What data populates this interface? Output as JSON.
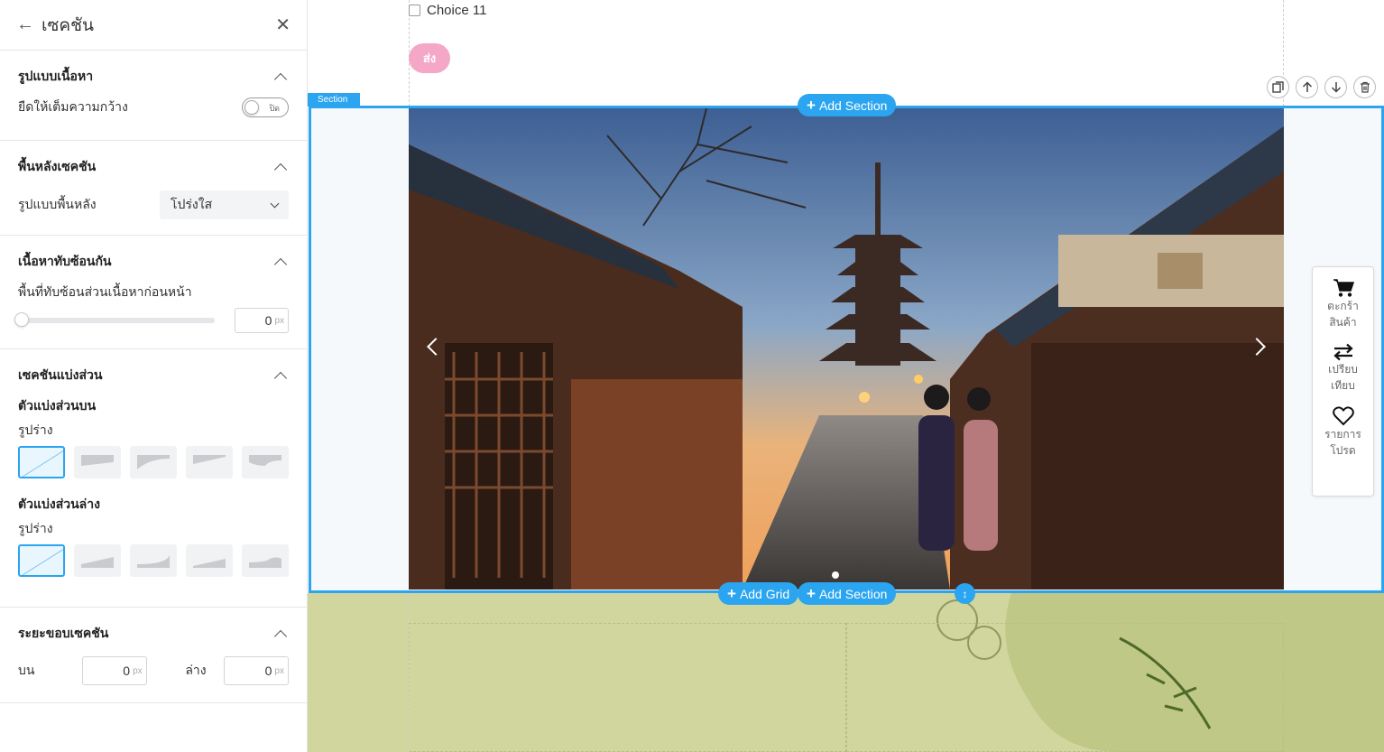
{
  "panel": {
    "title": "เซคชัน",
    "layout_group": {
      "title": "รูปแบบเนื้อหา",
      "stretch_label": "ยืดให้เต็มความกว้าง",
      "toggle_text": "ปิด"
    },
    "background_group": {
      "title": "พื้นหลังเซคชัน",
      "bg_type_label": "รูปแบบพื้นหลัง",
      "bg_type_value": "โปร่งใส"
    },
    "overlap_group": {
      "title": "เนื้อหาทับซ้อนกัน",
      "overlap_label": "พื้นที่ทับซ้อนส่วนเนื้อหาก่อนหน้า",
      "overlap_value": "0",
      "unit": "px"
    },
    "divider_group": {
      "title": "เซคชันแบ่งส่วน",
      "top_title": "ตัวแบ่งส่วนบน",
      "top_shape_label": "รูปร่าง",
      "bottom_title": "ตัวแบ่งส่วนล่าง",
      "bottom_shape_label": "รูปร่าง"
    },
    "padding_group": {
      "title": "ระยะขอบเซคชัน",
      "top_label": "บน",
      "top_value": "0",
      "bottom_label": "ล่าง",
      "bottom_value": "0",
      "unit": "px"
    }
  },
  "canvas": {
    "choice_label": "Choice 11",
    "send_label": "ส่ง",
    "section_tag": "Section",
    "add_section_label": "Add Section",
    "add_grid_label": "Add Grid",
    "sidebar": {
      "cart_label": "ตะกร้าสินค้า",
      "compare_label": "เปรียบเทียบ",
      "wishlist_label": "รายการโปรด"
    }
  },
  "colors": {
    "accent": "#2ba5f0",
    "send_button": "#f4a7c6",
    "lower_section_bg": "#d1d69e"
  }
}
